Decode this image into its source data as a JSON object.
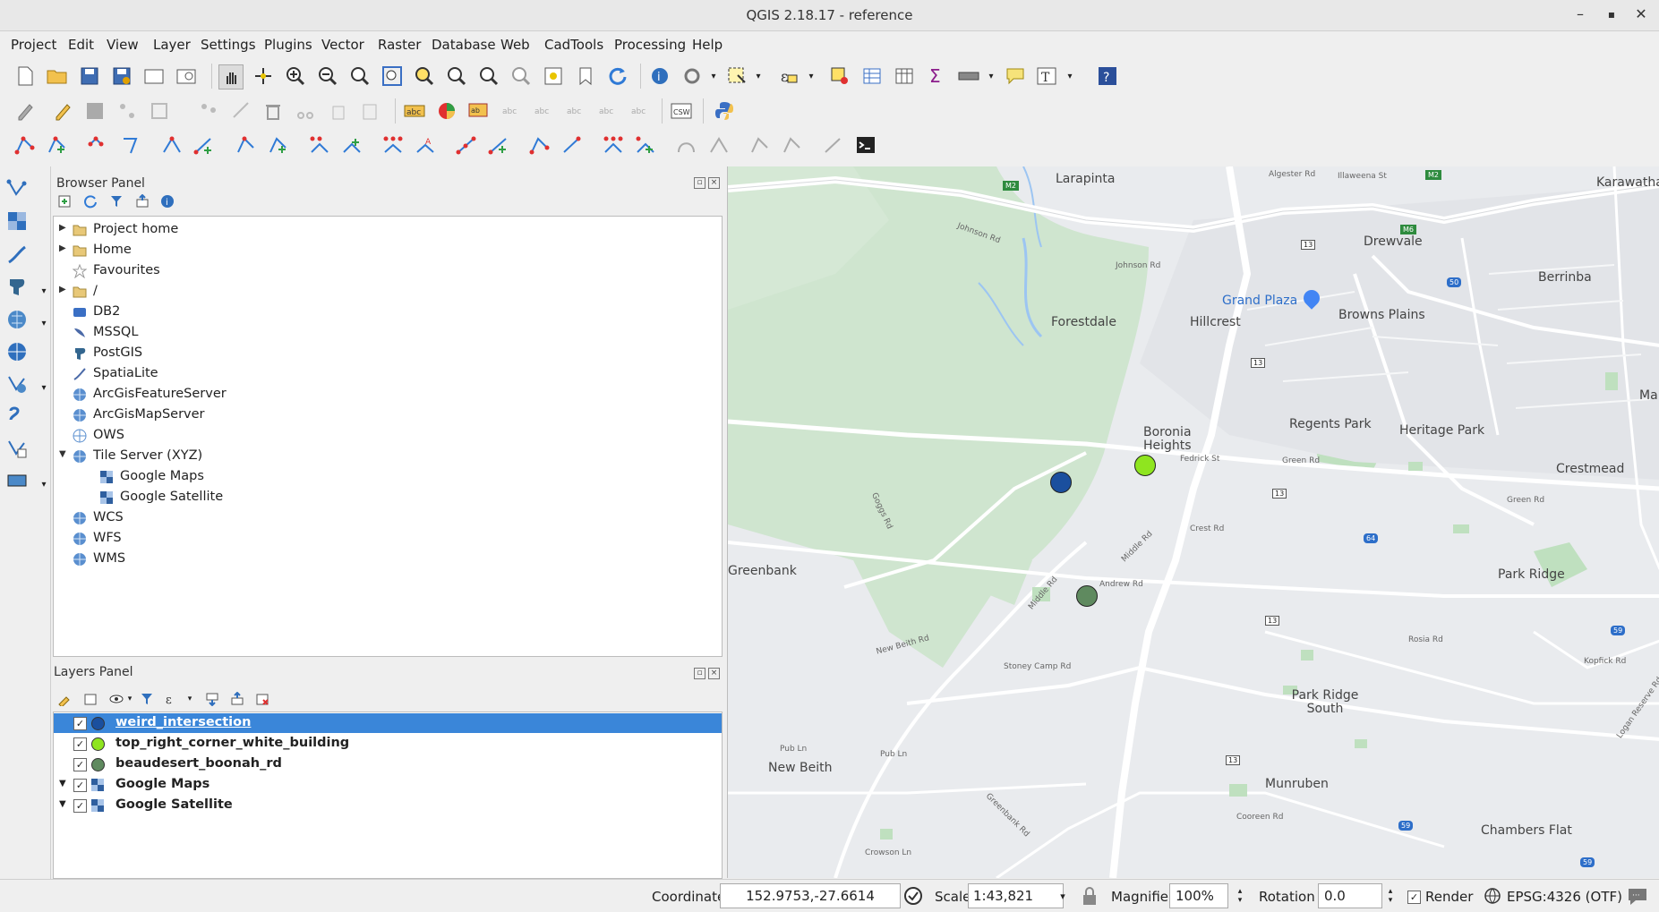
{
  "window": {
    "title": "QGIS 2.18.17 - reference",
    "minimize": "–",
    "maximize": "▪",
    "close": "✕"
  },
  "menu": [
    "Project",
    "Edit",
    "View",
    "Layer",
    "Settings",
    "Plugins",
    "Vector",
    "Raster",
    "Database",
    "Web",
    "CadTools",
    "Processing",
    "Help"
  ],
  "browser": {
    "title": "Browser Panel",
    "items": [
      {
        "label": "Project home",
        "icon": "folder-icon",
        "expandable": true
      },
      {
        "label": "Home",
        "icon": "folder-icon",
        "expandable": true
      },
      {
        "label": "Favourites",
        "icon": "star-icon",
        "expandable": false
      },
      {
        "label": "/",
        "icon": "folder-icon",
        "expandable": true
      },
      {
        "label": "DB2",
        "icon": "db2-icon",
        "expandable": false
      },
      {
        "label": "MSSQL",
        "icon": "mssql-icon",
        "expandable": false
      },
      {
        "label": "PostGIS",
        "icon": "postgis-icon",
        "expandable": false
      },
      {
        "label": "SpatiaLite",
        "icon": "spatialite-icon",
        "expandable": false
      },
      {
        "label": "ArcGisFeatureServer",
        "icon": "globe-icon",
        "expandable": false
      },
      {
        "label": "ArcGisMapServer",
        "icon": "globe-icon",
        "expandable": false
      },
      {
        "label": "OWS",
        "icon": "ows-icon",
        "expandable": false
      },
      {
        "label": "Tile Server (XYZ)",
        "icon": "globe-icon",
        "expandable": true,
        "expanded": true
      },
      {
        "label": "Google Maps",
        "icon": "tile-layer-icon",
        "child": true
      },
      {
        "label": "Google Satellite",
        "icon": "tile-layer-icon",
        "child": true
      },
      {
        "label": "WCS",
        "icon": "globe-icon",
        "expandable": false
      },
      {
        "label": "WFS",
        "icon": "globe-icon",
        "expandable": false
      },
      {
        "label": "WMS",
        "icon": "globe-icon",
        "expandable": false
      }
    ]
  },
  "layers": {
    "title": "Layers Panel",
    "items": [
      {
        "label": "weird_intersection",
        "color": "#1a4f9e",
        "selected": true,
        "kind": "point"
      },
      {
        "label": "top_right_corner_white_building",
        "color": "#8fe51f",
        "selected": false,
        "kind": "point"
      },
      {
        "label": "beaudesert_boonah_rd",
        "color": "#5f8a5f",
        "selected": false,
        "kind": "point"
      },
      {
        "label": "Google Maps",
        "color": "",
        "selected": false,
        "kind": "tile"
      },
      {
        "label": "Google Satellite",
        "color": "",
        "selected": false,
        "kind": "tile"
      }
    ]
  },
  "map": {
    "places": [
      "Larapinta",
      "Drewvale",
      "Karawatha",
      "Berrinba",
      "Grand Plaza",
      "Browns Plains",
      "Forestdale",
      "Hillcrest",
      "Boronia Heights",
      "Regents Park",
      "Heritage Park",
      "Crestmead",
      "Greenbank",
      "Park Ridge",
      "Park Ridge South",
      "New Beith",
      "Munruben",
      "Chambers Flat",
      "Ma"
    ],
    "roads": [
      "Algester Rd",
      "Illaweena St",
      "Johnson Rd",
      "Johnson Rd",
      "Fedrick St",
      "Green Rd",
      "Green Rd",
      "Crest Rd",
      "Andrew Rd",
      "Middle Rd",
      "Middle Rd",
      "Stoney Camp Rd",
      "New Beith Rd",
      "Goggs Rd",
      "Pub Ln",
      "Pub Ln",
      "Rosia Rd",
      "Kopfick Rd",
      "Cooreen Rd",
      "Crowson Ln",
      "Greenbank Rd",
      "Logan Reserve Rd"
    ],
    "shields": [
      "M2",
      "M2",
      "M6",
      "13",
      "13",
      "13",
      "13",
      "13",
      "50",
      "64",
      "59",
      "59",
      "59"
    ],
    "points": [
      {
        "layer": "weird_intersection",
        "color": "#1a4f9e"
      },
      {
        "layer": "top_right_corner_white_building",
        "color": "#8fe51f"
      },
      {
        "layer": "beaudesert_boonah_rd",
        "color": "#5f8a5f"
      }
    ]
  },
  "status": {
    "coordinate_label": "Coordinate",
    "coordinate_value": "152.9753,-27.6614",
    "scale_label": "Scale",
    "scale_value": "1:43,821",
    "magnifier_label": "Magnifier",
    "magnifier_value": "100%",
    "rotation_label": "Rotation",
    "rotation_value": "0.0",
    "render_label": "Render",
    "crs_label": "EPSG:4326 (OTF)"
  },
  "toolbar": {
    "csw_label": "CSW",
    "help_label": "?",
    "text_label": "T"
  }
}
